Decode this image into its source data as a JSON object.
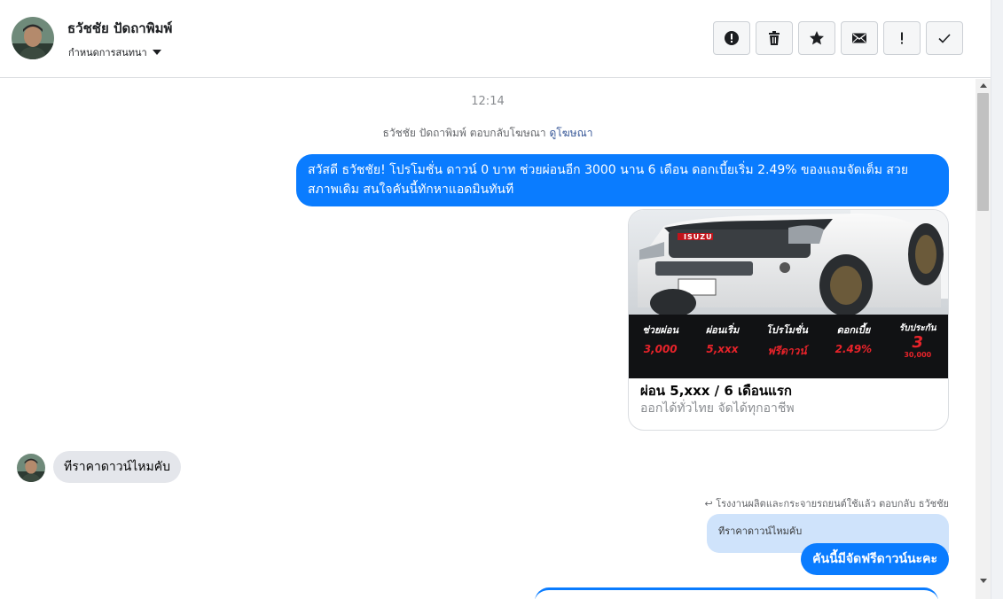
{
  "header": {
    "name": "ธวัชชัย ปัดถาพิมพ์",
    "subtitle": "กำหนดการสนทนา",
    "toolbar": [
      {
        "icon": "alert-circle-icon",
        "name": "spam-button"
      },
      {
        "icon": "trash-icon",
        "name": "delete-button"
      },
      {
        "icon": "star-icon",
        "name": "star-button"
      },
      {
        "icon": "envelope-icon",
        "name": "mark-unread-button"
      },
      {
        "icon": "exclamation-icon",
        "name": "follow-up-button"
      },
      {
        "icon": "checkmark-icon",
        "name": "mark-done-button"
      }
    ]
  },
  "chat": {
    "timestamp": "12:14",
    "reply_note_text": "ธวัชชัย ปัดถาพิมพ์ ตอบกลับโฆษณา",
    "reply_note_link": "ดูโฆษณา",
    "outgoing_message": "สวัสดี ธวัชชัย! โปรโมชั่น ดาวน์ 0 บาท ช่วยผ่อนอีก 3000 นาน 6 เดือน ดอกเบี้ยเริ่ม 2.49% ของแถมจัดเต็ม สวยสภาพเดิม สนใจคันนี้ทักหาแอดมินทันที",
    "ad": {
      "title": "ผ่อน 5,xxx / 6 เดือนแรก",
      "subtitle": "ออกได้ทั่วไทย จัดได้ทุกอาชีพ",
      "brand": "ISUZU",
      "promo": [
        {
          "label": "ช่วยผ่อน",
          "value": "3,000"
        },
        {
          "label": "ผ่อนเริ่ม",
          "value": "5,xxx"
        },
        {
          "label": "โปรโมชั่น",
          "value": "ฟรีดาวน์"
        },
        {
          "label": "ดอกเบี้ย",
          "value": "2.49%"
        },
        {
          "label": "รับประกัน",
          "value": "3"
        }
      ],
      "promo_sub": "30,000"
    },
    "incoming_message": "ทีราคาดาวน์ไหมคับ",
    "reply_meta": "โรงงานผลิตและกระจายรถยนต์ใช้แล้ว ตอบกลับ ธวัชชัย",
    "quoted_text": "ทีราคาดาวน์ไหมคับ",
    "reply_message": "คันนี้มีจัดฟรีดาวน์นะคะ"
  },
  "colors": {
    "accent": "#0a7cff",
    "incoming_bubble": "#e4e6eb",
    "quote_bg": "#cfe3fb",
    "promo_red": "#e8232a"
  }
}
